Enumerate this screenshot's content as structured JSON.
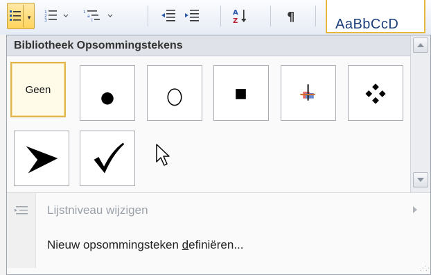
{
  "ribbon": {
    "style_preview": "AaBbCcD",
    "buttons": [
      "bullets-button",
      "numbering-button",
      "multilevel-list-button",
      "decrease-indent-button",
      "increase-indent-button",
      "sort-button",
      "show-formatting-marks-button"
    ]
  },
  "panel": {
    "title": "Bibliotheek Opsommingstekens",
    "bullets": [
      {
        "label": "Geen",
        "symbol": "none",
        "selected": true
      },
      {
        "label": "",
        "symbol": "filled-circle"
      },
      {
        "label": "",
        "symbol": "hollow-circle"
      },
      {
        "label": "",
        "symbol": "filled-square"
      },
      {
        "label": "",
        "symbol": "color-cross"
      },
      {
        "label": "",
        "symbol": "four-diamonds"
      },
      {
        "label": "",
        "symbol": "arrowhead"
      },
      {
        "label": "",
        "symbol": "checkmark"
      }
    ],
    "menu": {
      "change_level": "Lijstniveau wijzigen",
      "define_new_pre": "Nieuw opsommingsteken ",
      "define_new_accel": "d",
      "define_new_post": "efiniëren..."
    }
  },
  "colors": {
    "selection_border": "#e0b54a",
    "highlight": "#ffd35c",
    "disabled_text": "#9aa0a8"
  }
}
